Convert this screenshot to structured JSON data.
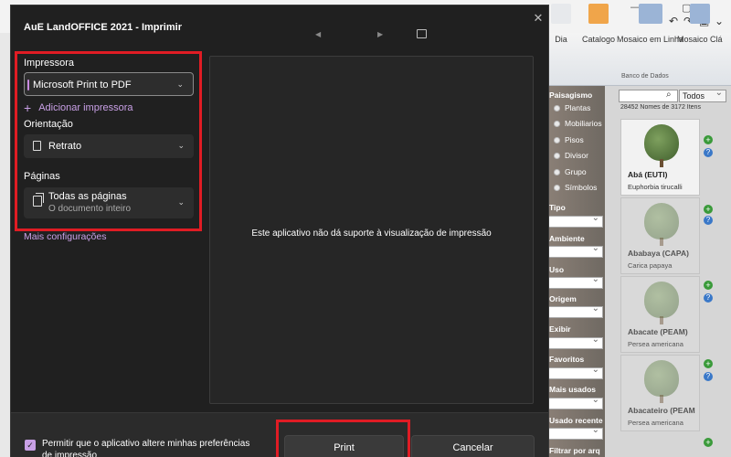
{
  "background_app": {
    "window_controls": [
      "—",
      "▢"
    ],
    "quick_access": [
      "↶",
      "↷",
      "▣",
      "⌄"
    ],
    "ribbon": {
      "partial_button": "Dia",
      "buttons": [
        {
          "label": "Catalogo",
          "icon": "search-catalog-icon"
        },
        {
          "label": "Mosaico em Linha",
          "icon": "mosaic-line-icon"
        },
        {
          "label": "Mosaico Clá",
          "icon": "mosaic-classic-icon"
        }
      ],
      "group_label": "Banco de Dados"
    },
    "side_panel": {
      "title": "Paisagismo",
      "radios": [
        "Plantas",
        "Mobiliarios",
        "Pisos",
        "Divisor",
        "Grupo",
        "Símbolos"
      ],
      "filters": [
        "Tipo",
        "Ambiente",
        "Uso",
        "Origem",
        "Exibir",
        "Favoritos",
        "Mais usados",
        "Usado recente",
        "Filtrar por arq"
      ]
    },
    "catalog": {
      "filter_value": "Todos",
      "count_text": "28452 Nomes de 3172 Itens",
      "items": [
        {
          "name": "Abá (EUTI)",
          "scientific": "Euphorbia tirucalli"
        },
        {
          "name": "Ababaya (CAPA)",
          "scientific": "Carica papaya"
        },
        {
          "name": "Abacate (PEAM)",
          "scientific": "Persea americana"
        },
        {
          "name": "Abacateiro (PEAM",
          "scientific": "Persea americana"
        }
      ]
    }
  },
  "dialog": {
    "title": "AuE LandOFFICE 2021 - Imprimir",
    "close_symbol": "✕",
    "nav_prev": "◀",
    "nav_next": "▶",
    "printer_label": "Impressora",
    "printer_value": "Microsoft Print to PDF",
    "add_printer": "Adicionar impressora",
    "orientation_label": "Orientação",
    "orientation_value": "Retrato",
    "pages_label": "Páginas",
    "pages_value": "Todas as páginas",
    "pages_sub": "O documento inteiro",
    "more_settings": "Mais configurações",
    "preview_message": "Este aplicativo não dá suporte à visualização de impressão",
    "checkbox_label": "Permitir que o aplicativo altere minhas preferências de impressão",
    "checkbox_checked": true,
    "print_button": "Print",
    "cancel_button": "Cancelar",
    "chevron": "⌄"
  },
  "colors": {
    "highlight": "#e01c24",
    "accent": "#c9a0e6",
    "dialog_bg": "#202020"
  }
}
